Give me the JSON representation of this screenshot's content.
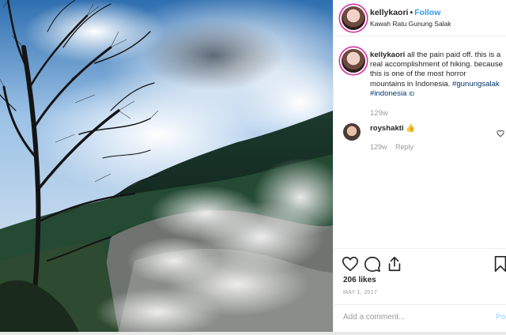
{
  "post": {
    "photo_alt_icon": "landscape-photo",
    "author": {
      "username": "kellykaori",
      "dot": "•",
      "follow_label": "Follow",
      "location": "Kawah Ratu Gunung Salak"
    },
    "caption": {
      "username": "kellykaori",
      "text": "all the pain paid off. this is a real accomplishment of hiking. because this is one of the most horror mountains in Indonesia.",
      "tags": "#gunungsalak #indonesia",
      "tag_suffix": "ID",
      "time": "129w"
    },
    "comments": [
      {
        "username": "royshakti",
        "text": "👍",
        "time": "129w",
        "reply_label": "Reply"
      }
    ],
    "actions": {
      "like_icon": "heart-icon",
      "comment_icon": "comment-icon",
      "share_icon": "share-icon",
      "save_icon": "bookmark-icon"
    },
    "likes": "206 likes",
    "date": "MAY 1, 2017",
    "comment_box": {
      "placeholder": "Add a comment...",
      "post_label": "Post"
    }
  },
  "colors": {
    "accent": "#3897f0",
    "hashtag": "#003569",
    "muted": "#999999"
  }
}
